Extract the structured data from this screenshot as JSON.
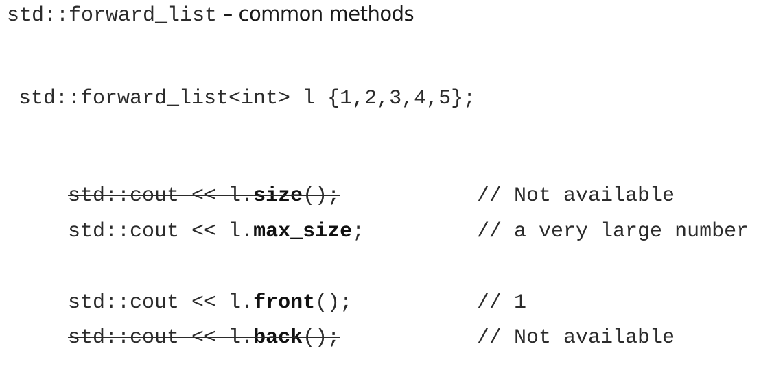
{
  "title": {
    "code": "std::forward_list",
    "text": " – common methods"
  },
  "declaration": "std::forward_list<int> l {1,2,3,4,5};",
  "lines": [
    {
      "prefix": "std::cout << l.",
      "method": "size",
      "suffix": "();",
      "comment": "// Not available",
      "struck": true
    },
    {
      "prefix": "std::cout << l.",
      "method": "max_size",
      "suffix": ";",
      "comment": "// a very large number",
      "struck": false
    },
    {
      "prefix": "std::cout << l.",
      "method": "front",
      "suffix": "();",
      "comment": "// 1",
      "struck": false
    },
    {
      "prefix": "std::cout << l.",
      "method": "back",
      "suffix": "();",
      "comment": "// Not available",
      "struck": true
    }
  ]
}
